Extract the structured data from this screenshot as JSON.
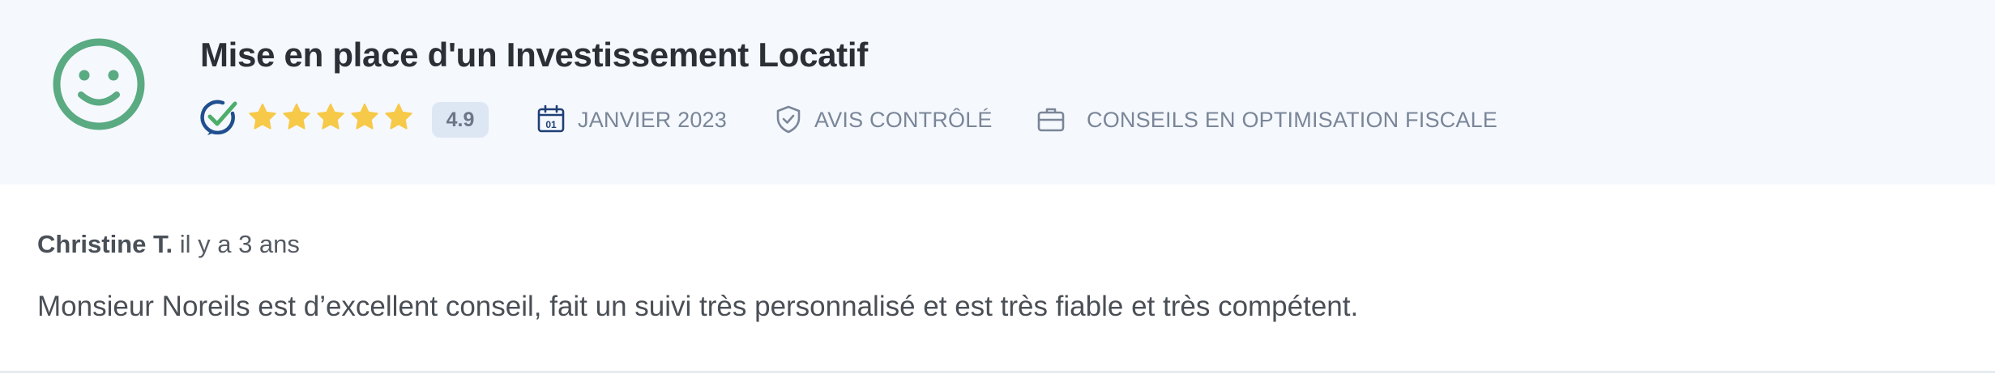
{
  "review": {
    "title": "Mise en place d'un Investissement Locatif",
    "rating": 4.9,
    "rating_label": "4.9",
    "stars": 5,
    "date": "JANVIER 2023",
    "calendar_day": "01",
    "status": "AVIS CONTRÔLÉ",
    "category": "CONSEILS EN OPTIMISATION FISCALE",
    "author": "Christine T.",
    "time_ago": "il y a 3 ans",
    "text": "Monsieur Noreils est d’excellent conseil, fait un suivi très personnalisé et est très fiable et très compétent."
  },
  "icons": {
    "mood": "smiley-face-icon",
    "verified": "verified-check-icon",
    "star": "star-icon",
    "date": "calendar-icon",
    "status": "shield-check-icon",
    "category": "briefcase-icon"
  },
  "colors": {
    "header_bg": "#f5f8fd",
    "smiley": "#5aaa82",
    "star": "#f7c948",
    "verified_blue": "#1f4f8f",
    "verified_green": "#4cae6a",
    "meta_text": "#7a8698",
    "badge_bg": "#dde7f4",
    "title": "#2b2f36",
    "body_text": "#4a4f56"
  }
}
